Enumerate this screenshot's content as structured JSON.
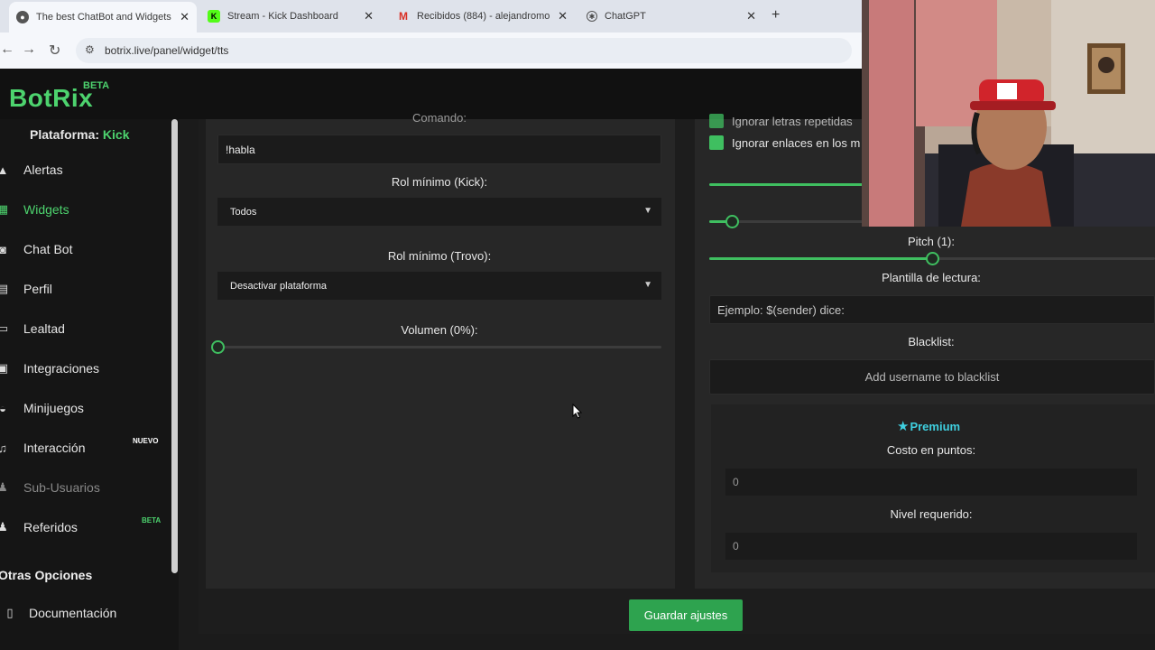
{
  "browser": {
    "tabs": [
      {
        "title": "The best ChatBot and Widgets f",
        "active": true,
        "icon": "browser-globe-icon"
      },
      {
        "title": "Stream - Kick Dashboard",
        "active": false,
        "icon": "kick-logo-icon"
      },
      {
        "title": "Recibidos (884) - alejandromo",
        "active": false,
        "icon": "gmail-icon"
      },
      {
        "title": "ChatGPT",
        "active": false,
        "icon": "chatgpt-icon"
      }
    ],
    "url": "botrix.live/panel/widget/tts"
  },
  "app": {
    "logo": "BotRix",
    "logo_badge": "BETA",
    "accent": "#4dd36e"
  },
  "sidebar": {
    "platform_label": "Plataforma:",
    "platform_value": "Kick",
    "items": [
      {
        "label": "Alertas",
        "icon": "warning-icon"
      },
      {
        "label": "Widgets",
        "icon": "grid-icon",
        "active": true
      },
      {
        "label": "Chat Bot",
        "icon": "robot-icon"
      },
      {
        "label": "Perfil",
        "icon": "id-card-icon"
      },
      {
        "label": "Lealtad",
        "icon": "ticket-icon"
      },
      {
        "label": "Integraciones",
        "icon": "plug-icon"
      },
      {
        "label": "Minijuegos",
        "icon": "gamepad-icon"
      },
      {
        "label": "Interacción",
        "icon": "music-icon",
        "badge": "NUEVO"
      },
      {
        "label": "Sub-Usuarios",
        "icon": "users-icon",
        "disabled": true
      },
      {
        "label": "Referidos",
        "icon": "people-icon",
        "badge": "BETA"
      }
    ],
    "section_title": "Otras Opciones",
    "extra_items": [
      {
        "label": "Documentación",
        "icon": "book-icon"
      }
    ]
  },
  "form_left": {
    "command_label": "Comando:",
    "command_value": "!habla",
    "kick_role_label": "Rol mínimo (Kick):",
    "kick_role_value": "Todos",
    "trovo_role_label": "Rol mínimo (Trovo):",
    "trovo_role_value": "Desactivar plataforma",
    "volume_label": "Volumen (0%):",
    "volume_percent": 0
  },
  "form_right": {
    "checkbox_ignore_repeated": "Ignorar letras repetidas",
    "checkbox_ignore_links": "Ignorar enlaces en los m",
    "speed_fraction": 0.05,
    "pitch_label": "Pitch (1):",
    "pitch_fraction": 0.5,
    "template_label": "Plantilla de lectura:",
    "template_placeholder": "Ejemplo: $(sender) dice:",
    "blacklist_label": "Blacklist:",
    "blacklist_placeholder": "Add username to blacklist",
    "premium_title": "Premium",
    "cost_label": "Costo en puntos:",
    "cost_value": "0",
    "level_label": "Nivel requerido:",
    "level_value": "0"
  },
  "save_button": "Guardar ajustes"
}
